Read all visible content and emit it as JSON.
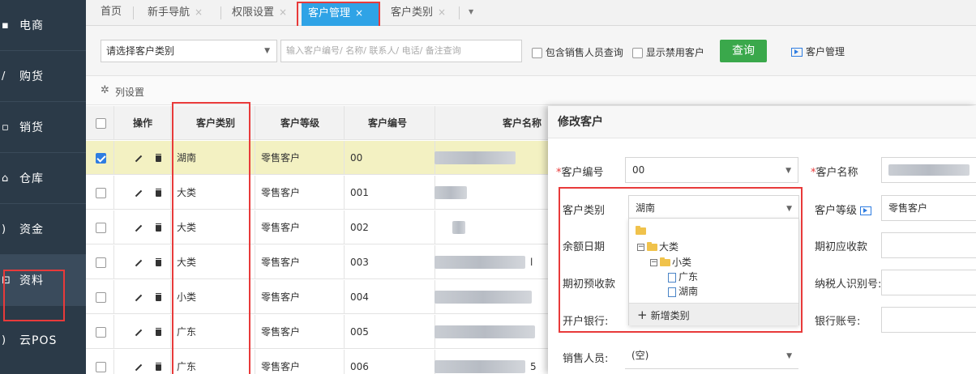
{
  "sidebar": {
    "items": [
      {
        "label": "电商",
        "icon": "shop-icon"
      },
      {
        "label": "购货",
        "icon": "purchase-icon"
      },
      {
        "label": "销货",
        "icon": "sales-icon"
      },
      {
        "label": "仓库",
        "icon": "warehouse-icon"
      },
      {
        "label": "资金",
        "icon": "money-icon"
      },
      {
        "label": "资料",
        "icon": "data-icon"
      },
      {
        "label": "云POS",
        "icon": "pos-icon"
      }
    ]
  },
  "tabs": [
    {
      "label": "首页",
      "closable": false
    },
    {
      "label": "新手导航",
      "closable": true
    },
    {
      "label": "权限设置",
      "closable": true
    },
    {
      "label": "客户管理",
      "closable": true,
      "active": true
    },
    {
      "label": "客户类别",
      "closable": true
    }
  ],
  "tab_close": "×",
  "tab_more": "▼",
  "filter": {
    "category_select": "请选择客户类别",
    "search_placeholder": "输入客户编号/ 名称/ 联系人/ 电话/ 备注查询",
    "include_sales_label": "包含销售人员查询",
    "show_disabled_label": "显示禁用客户",
    "query_button": "查询",
    "manage_link": "客户管理"
  },
  "column_settings": "列设置",
  "table": {
    "headers": [
      "操作",
      "客户类别",
      "客户等级",
      "客户编号",
      "客户名称"
    ],
    "rows": [
      {
        "category": "湖南",
        "level": "零售客户",
        "code": "00",
        "checked": true,
        "highlight": true,
        "name_suffix": ""
      },
      {
        "category": "大类",
        "level": "零售客户",
        "code": "001",
        "checked": false,
        "highlight": false,
        "name_suffix": ""
      },
      {
        "category": "大类",
        "level": "零售客户",
        "code": "002",
        "checked": false,
        "highlight": false,
        "name_suffix": ""
      },
      {
        "category": "大类",
        "level": "零售客户",
        "code": "003",
        "checked": false,
        "highlight": false,
        "name_suffix": "l"
      },
      {
        "category": "小类",
        "level": "零售客户",
        "code": "004",
        "checked": false,
        "highlight": false,
        "name_suffix": ""
      },
      {
        "category": "广东",
        "level": "零售客户",
        "code": "005",
        "checked": false,
        "highlight": false,
        "name_suffix": ""
      },
      {
        "category": "广东",
        "level": "零售客户",
        "code": "006",
        "checked": false,
        "highlight": false,
        "name_suffix": "5"
      }
    ]
  },
  "modal": {
    "title": "修改客户",
    "fields": {
      "code_label": "客户编号",
      "code_value": "00",
      "name_label": "客户名称",
      "category_label": "客户类别",
      "category_value": "湖南",
      "level_label": "客户等级",
      "level_value": "零售客户",
      "balance_date_label": "余额日期",
      "opening_receivable_label": "期初应收款",
      "opening_prepaid_label": "期初预收款",
      "tax_id_label": "纳税人识别号:",
      "bank_label": "开户银行:",
      "account_label": "银行账号:",
      "salesperson_label": "销售人员:",
      "salesperson_value": "(空)"
    },
    "required_mark": "*",
    "tree": {
      "nodes": [
        "大类",
        "小类",
        "广东",
        "湖南"
      ],
      "toggle": "−",
      "add_label": "新增类别",
      "add_icon": "+"
    }
  },
  "colors": {
    "sidebar_bg": "#2b3a48",
    "accent": "#2fa3e6",
    "query_green": "#3aa84b",
    "highlight_row": "#f3f1c2",
    "annotation_red": "#e83a3a"
  }
}
